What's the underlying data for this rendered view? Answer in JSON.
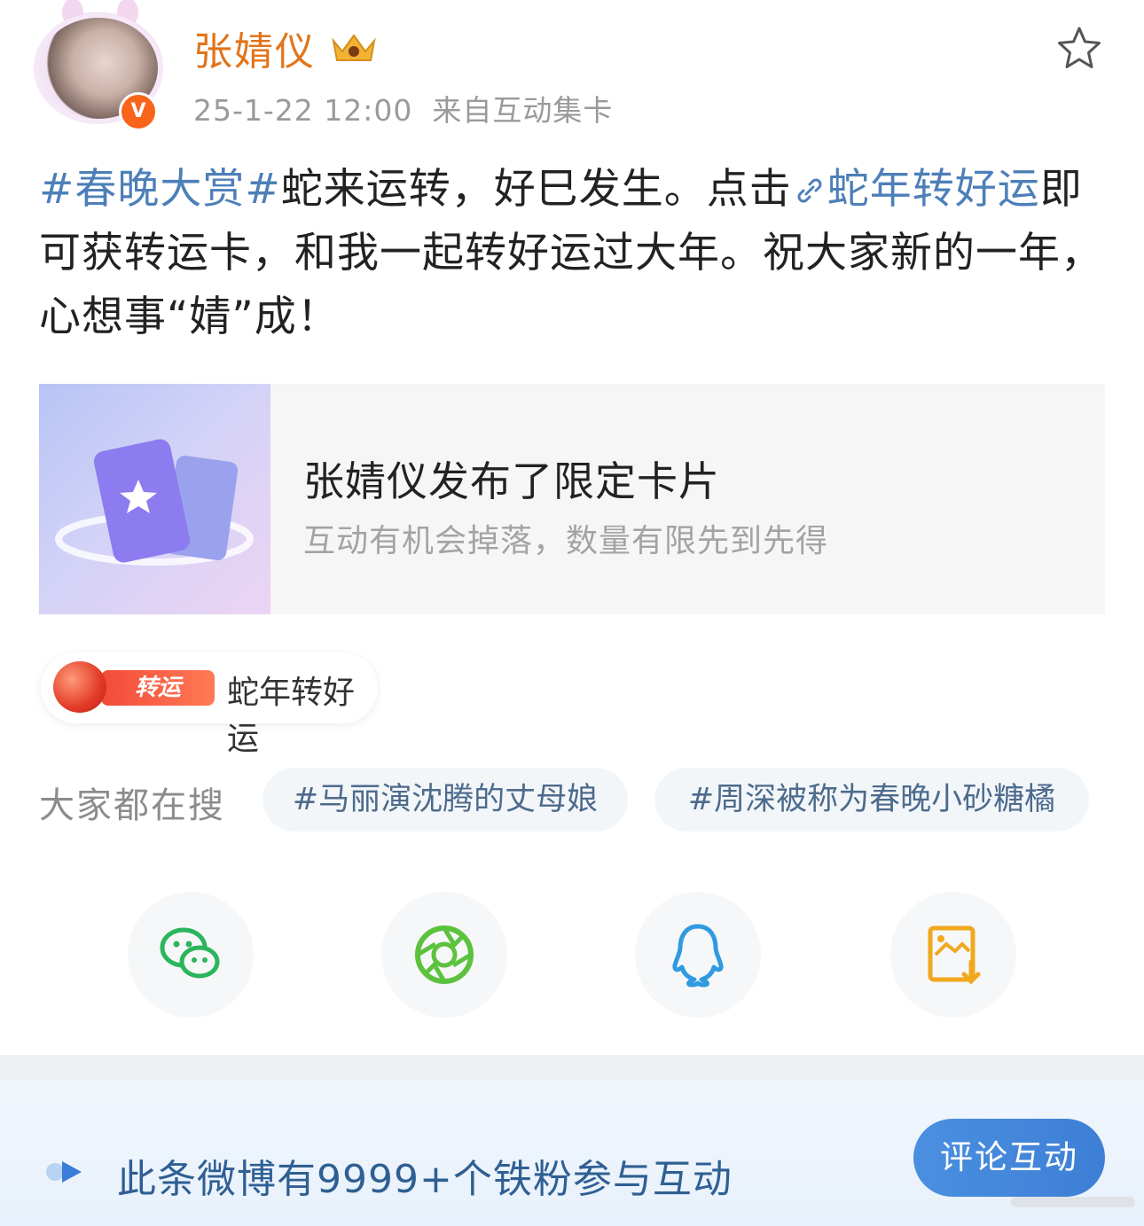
{
  "header": {
    "username": "张婧仪",
    "date": "25-1-22 12:00",
    "source": "来自互动集卡"
  },
  "post": {
    "hashtag": "#春晚大赏#",
    "text_1": "蛇来运转，好巳发生。点击",
    "link_label": "蛇年转好运",
    "text_2": "即可获转运卡，和我一起转好运过大年。祝大家新的一年，心想事“婧”成！"
  },
  "card": {
    "title": "张婧仪发布了限定卡片",
    "subtitle": "互动有机会掉落，数量有限先到先得"
  },
  "topic": {
    "tag": "转运",
    "label": "蛇年转好运"
  },
  "searches": {
    "label": "大家都在搜",
    "items": [
      "#马丽演沈腾的丈母娘",
      "#周深被称为春晚小砂糖橘"
    ]
  },
  "share": {
    "icons": [
      "wechat-icon",
      "moments-icon",
      "qq-icon",
      "save-image-icon"
    ]
  },
  "bottom_bar": {
    "text": "此条微博有9999+个铁粉参与互动",
    "button": "评论互动"
  },
  "colors": {
    "username": "#e2741a",
    "link_blue": "#4d7fb8",
    "button_blue": "#3e7fd6",
    "wechat_green": "#2bb55c",
    "moments_green": "#5cc23e",
    "qq_blue": "#2f9ae0",
    "save_yellow": "#f0a81e"
  }
}
